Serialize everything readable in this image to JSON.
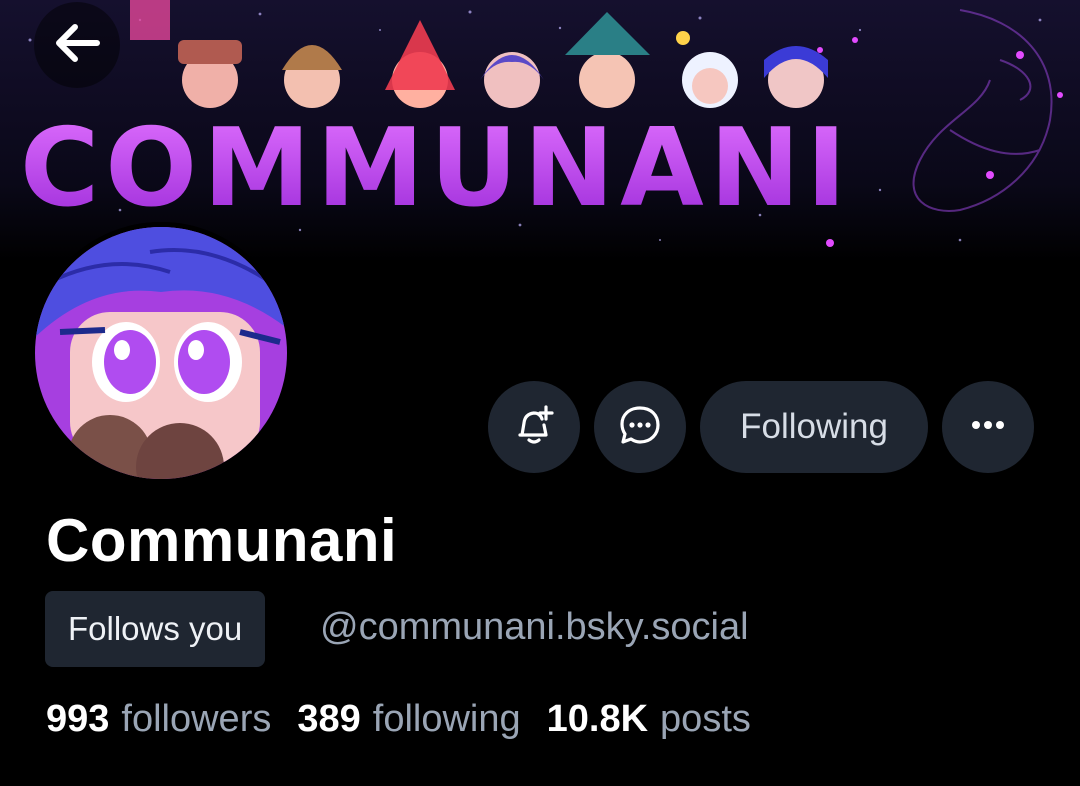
{
  "profile": {
    "banner_text": "COMMUNANI",
    "display_name": "Communani",
    "follows_you_label": "Follows you",
    "handle": "@communani.bsky.social"
  },
  "actions": {
    "subscribe_icon": "bell-plus-icon",
    "message_icon": "chat-bubble-icon",
    "following_label": "Following",
    "more_icon": "more-horizontal-icon"
  },
  "stats": {
    "followers_count": "993",
    "followers_label": "followers",
    "following_count": "389",
    "following_label": "following",
    "posts_count": "10.8K",
    "posts_label": "posts"
  },
  "colors": {
    "background": "#000000",
    "button_bg": "#1f2631",
    "muted_text": "#9aa5b5",
    "banner_purple": "#c13bf0"
  }
}
